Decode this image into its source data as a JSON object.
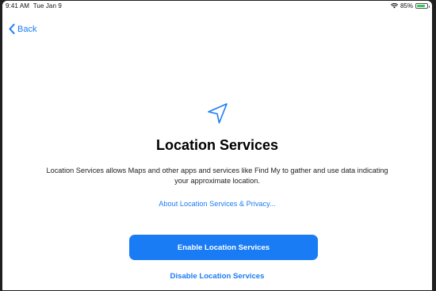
{
  "status_bar": {
    "time": "9:41 AM",
    "date": "Tue Jan 9",
    "wifi_icon": "wifi-icon",
    "battery_percent": "85%",
    "battery_level": 0.85,
    "battery_color": "#34c759"
  },
  "nav": {
    "back_label": "Back",
    "back_icon": "chevron-left-icon"
  },
  "main": {
    "icon": "location-arrow-icon",
    "title": "Location Services",
    "description": "Location Services allows Maps and other apps and services like Find My to gather and use data indicating your approximate location.",
    "privacy_link": "About Location Services & Privacy...",
    "enable_button": "Enable Location Services",
    "disable_button": "Disable Location Services"
  },
  "colors": {
    "accent": "#1a7cf5",
    "background": "#ffffff"
  }
}
